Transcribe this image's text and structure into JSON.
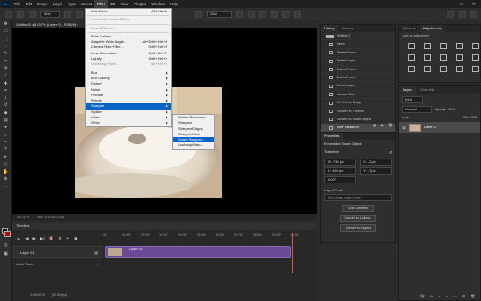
{
  "menubar": {
    "logo": "Ps",
    "items": [
      "File",
      "Edit",
      "Image",
      "Layer",
      "Type",
      "Select",
      "Filter",
      "3D",
      "View",
      "Plugins",
      "Window",
      "Help"
    ],
    "active_index": 6,
    "window_controls": [
      "—",
      "□",
      "✕"
    ]
  },
  "options_bar": {
    "preset_value": "Grid",
    "size_value": "Grid"
  },
  "document": {
    "tab_title": "Untitled-2 @ 157% (Layer 01, RGB/8) *",
    "status_zoom": "157.47%",
    "status_doc": "Doc: 972.0K/1.27M"
  },
  "filter_menu": {
    "items": [
      {
        "label": "Add Noise",
        "shortcut": "Alt+Ctrl+F",
        "disabled": false
      },
      {
        "sep": true
      },
      {
        "label": "Convert for Smart Filters",
        "shortcut": "",
        "disabled": true
      },
      {
        "sep": true
      },
      {
        "label": "Neural Filters...",
        "shortcut": "",
        "disabled": true
      },
      {
        "sep": true
      },
      {
        "label": "Filter Gallery...",
        "shortcut": "",
        "disabled": false
      },
      {
        "label": "Adaptive Wide Angle...",
        "shortcut": "Alt+Shift+Ctrl+A",
        "disabled": false
      },
      {
        "label": "Camera Raw Filter...",
        "shortcut": "Shift+Ctrl+A",
        "disabled": false
      },
      {
        "label": "Lens Correction...",
        "shortcut": "Shift+Ctrl+R",
        "disabled": false
      },
      {
        "label": "Liquify...",
        "shortcut": "Shift+Ctrl+X",
        "disabled": false
      },
      {
        "label": "Vanishing Point...",
        "shortcut": "Alt+Ctrl+V",
        "disabled": true
      },
      {
        "sep": true
      },
      {
        "label": "Blur",
        "arrow": true
      },
      {
        "label": "Blur Gallery",
        "arrow": true
      },
      {
        "label": "Distort",
        "arrow": true
      },
      {
        "label": "Noise",
        "arrow": true
      },
      {
        "label": "Pixelate",
        "arrow": true
      },
      {
        "label": "Render",
        "arrow": true
      },
      {
        "label": "Sharpen",
        "arrow": true,
        "highlight": true
      },
      {
        "label": "Stylize",
        "arrow": true
      },
      {
        "label": "Video",
        "arrow": true
      },
      {
        "label": "Other",
        "arrow": true
      }
    ]
  },
  "sharpen_submenu": {
    "items": [
      {
        "label": "Shake Reduction..."
      },
      {
        "label": "Sharpen"
      },
      {
        "label": "Sharpen Edges"
      },
      {
        "label": "Sharpen More"
      },
      {
        "label": "Smart Sharpen...",
        "highlight": true
      },
      {
        "label": "Unsharp Mask..."
      }
    ]
  },
  "history_panel": {
    "tabs": [
      "History",
      "Actions"
    ],
    "items": [
      {
        "label": "Untitled-2",
        "thumb": true
      },
      {
        "label": "Open"
      },
      {
        "label": "Delete Frame"
      },
      {
        "label": "Delete Layer"
      },
      {
        "label": "Delete Frame"
      },
      {
        "label": "Delete Frame"
      },
      {
        "label": "Delete Layer"
      },
      {
        "label": "Canvas Size"
      },
      {
        "label": "Set Frame Delay"
      },
      {
        "label": "Convert to Timeline"
      },
      {
        "label": "Convert to Smart Object"
      },
      {
        "label": "Free Transform",
        "selected": true
      }
    ]
  },
  "libraries_panel": {
    "tabs": [
      "Libraries",
      "Adjustments"
    ],
    "hint": "Add an adjustment"
  },
  "properties_panel": {
    "tab": "Properties",
    "object_type": "Embedded Smart Object",
    "section": "Transform",
    "w": "W: 738 px",
    "h": "H: 446 px",
    "x": "X: -2 px",
    "y": "Y: -7 px",
    "angle": "0.00°",
    "layer_file": "Layer 01.psb",
    "comp_placeholder": "Don't Apply Layer Comp",
    "buttons": [
      "Edit Contents",
      "Convert to Linked...",
      "Convert to Layers"
    ]
  },
  "layers_panel": {
    "tabs": [
      "Layers",
      "Channels"
    ],
    "filter": "Kind",
    "blend": "Normal",
    "opacity": "Opacity: 100%",
    "lock": "Lock:",
    "fill": "Fill: 100%",
    "layer_name": "Layer 01"
  },
  "timeline": {
    "title": "Timeline",
    "ruler": [
      "00",
      "01:00f",
      "02:00f",
      "03:00f",
      "04:00f",
      "05:00f",
      "06:00f",
      "07:00f",
      "08:00f",
      "09:00f",
      "10:00f"
    ],
    "track_label": "Layer 01",
    "clip_label": "Layer 01",
    "audio_label": "Audio Track",
    "timecode": "0:00:00:00",
    "fps": "(30.00 fps)"
  }
}
